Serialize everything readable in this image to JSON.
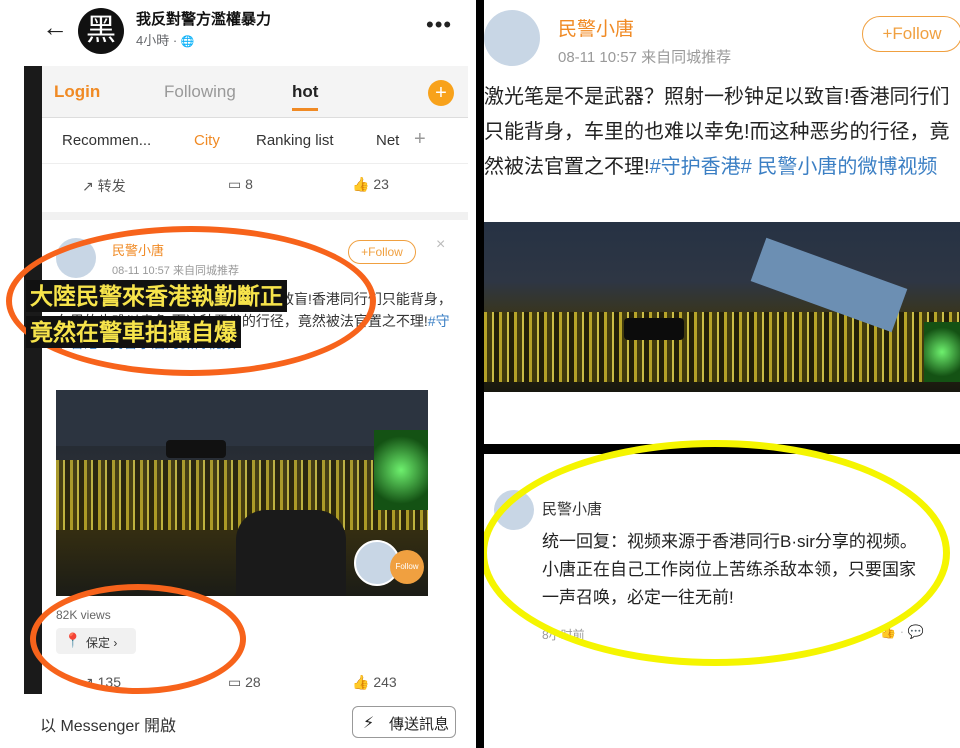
{
  "fb": {
    "back_icon": "←",
    "avatar_char": "黑",
    "page_name": "我反對警方濫權暴力",
    "timestamp": "4小時",
    "globe_icon": "🌐",
    "more_icon": "•••",
    "messenger_label": "以 Messenger 開啟",
    "send_label": "傳送訊息"
  },
  "weibo_feed": {
    "tabs": {
      "login": "Login",
      "following": "Following",
      "hot": "hot"
    },
    "plus": "+",
    "subtabs": [
      "Recommen...",
      "City",
      "Ranking list",
      "Net"
    ],
    "subplus": "+",
    "top_actions": {
      "repost": "转发",
      "comments": "8",
      "likes": "23"
    },
    "post": {
      "username": "民警小唐",
      "meta": "08-11 10:57  来自同城推荐",
      "follow": "+Follow",
      "close": "×",
      "text_pre": "激光笔是不是武器？照射一秒钟足以致盲!香港同行们只能背身，车里的也难以幸免!而这种恶劣的行径，竟然被法官置之不理!",
      "text_tag": "#守护香港#",
      "text_link": "民警小唐的微博视频",
      "video_follow": "Follow",
      "views": "82K views",
      "location": "保定",
      "repost_count": "135",
      "comment_count": "28",
      "like_count": "243"
    }
  },
  "caption": {
    "line1": "大陸民警來香港執勤斷正",
    "line2": "竟然在警車拍攝自爆"
  },
  "zoom": {
    "username": "民警小唐",
    "meta": "08-11 10:57  来自同城推荐",
    "follow": "+Follow",
    "text": "激光笔是不是武器？照射一秒钟足以致盲!香港同行们只能背身，车里的也难以幸免!而这种恶劣的行径，竟然被法官置之不理!",
    "tag": "#守护香港#",
    "link": "民警小唐的微博视频"
  },
  "reply": {
    "username": "民警小唐",
    "text": "统一回复：视频来源于香港同行B·sir分享的视频。小唐正在自己工作岗位上苦练杀敌本领，只要国家一声召唤，必定一往无前!",
    "time": "8小时前",
    "icons": "👍 ·  💬"
  },
  "colors": {
    "orange_annotation": "#f7631b",
    "yellow_annotation": "#f5f500",
    "weibo_orange": "#f08a24"
  }
}
